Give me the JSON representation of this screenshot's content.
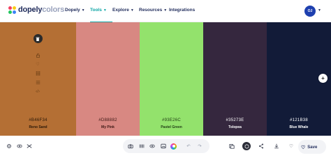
{
  "header": {
    "logo_bold": "dopely",
    "logo_light": "colors",
    "nav": [
      {
        "label": "Dopely",
        "has_menu": true,
        "active": false
      },
      {
        "label": "Tools",
        "has_menu": true,
        "active": true
      },
      {
        "label": "Explore",
        "has_menu": true,
        "active": false
      },
      {
        "label": "Resources",
        "has_menu": true,
        "active": false
      },
      {
        "label": "Integrations",
        "has_menu": false,
        "active": false
      }
    ],
    "avatar_initials": "OJ"
  },
  "palette": {
    "swatches": [
      {
        "hex": "#B46F34",
        "name": "Reno Sand",
        "color": "#b46f34",
        "text_color": "#2a1808"
      },
      {
        "hex": "#D88882",
        "name": "My Pink",
        "color": "#d88882",
        "text_color": "#3b1714"
      },
      {
        "hex": "#93E26C",
        "name": "Pastel Green",
        "color": "#93e26c",
        "text_color": "#1f3a14"
      },
      {
        "hex": "#35273E",
        "name": "Tolopea",
        "color": "#35273e",
        "text_color": "#ffffff"
      },
      {
        "hex": "#121B38",
        "name": "Blue Whale",
        "color": "#121b38",
        "text_color": "#ffffff"
      }
    ],
    "tool_icons": [
      "trash-icon",
      "lock-icon",
      "heart-icon",
      "grid-icon",
      "menu-icon",
      "code-icon"
    ],
    "add_icon": "plus-icon"
  },
  "toolbar": {
    "left_icons": [
      "settings-icon",
      "eye-icon",
      "shuffle-icon"
    ],
    "center_icons": [
      "camera-icon",
      "barcode-icon",
      "eye-icon",
      "image-icon",
      "color-wheel-icon",
      "undo-icon",
      "redo-icon"
    ],
    "right_icons": [
      "library-icon",
      "dark-mode-icon",
      "share-icon",
      "download-icon",
      "heart-icon"
    ],
    "save_label": "Save"
  }
}
